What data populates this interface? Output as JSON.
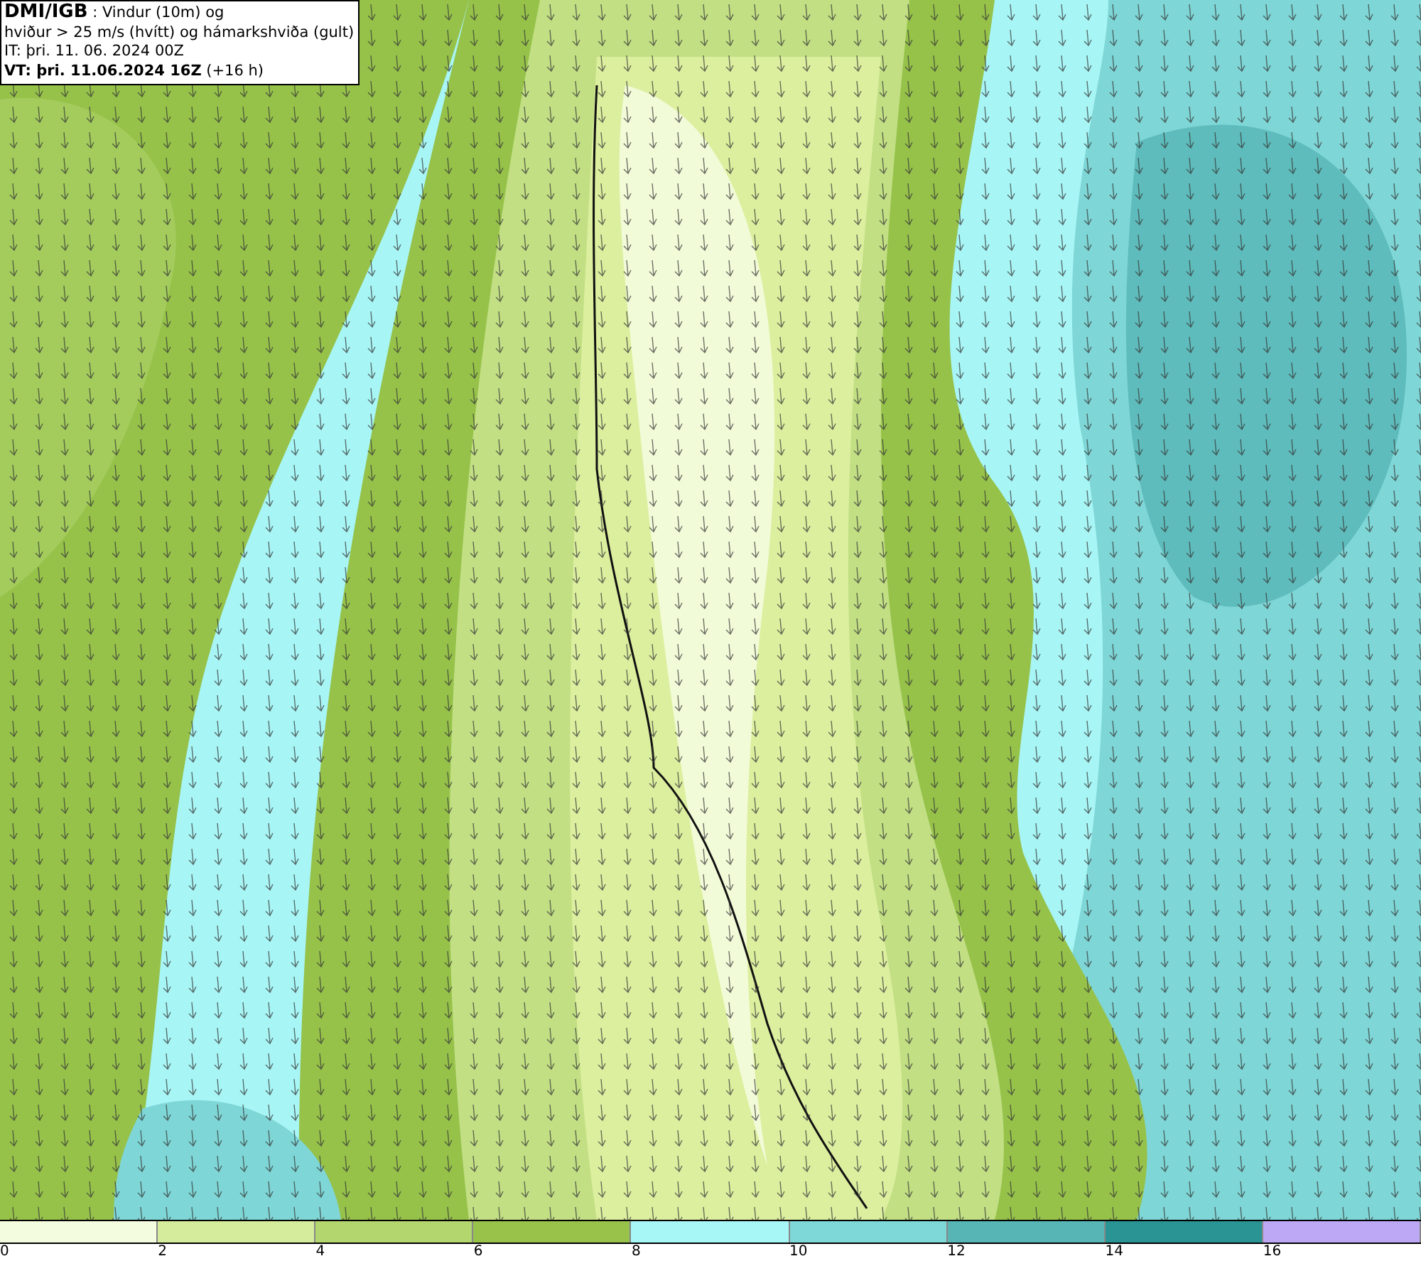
{
  "header": {
    "lines": [
      "**DMI/IGB** : Vindur (10m) og",
      "hviður > 25 m/s (hvítt) og hámarkshviða (gult)",
      "IT: þri. 11. 06. 2024 00Z",
      "**VT: þri. 11.06.2024 16Z** (+16 h)"
    ]
  },
  "legend": {
    "segments": [
      {
        "color": "#f3fcde"
      },
      {
        "color": "#d4ec9c"
      },
      {
        "color": "#b4d66e"
      },
      {
        "color": "#98c24a"
      },
      {
        "color": "#a8f7f7"
      },
      {
        "color": "#7fd8d8"
      },
      {
        "color": "#57b5b5"
      },
      {
        "color": "#2a9494"
      },
      {
        "color": "#bca8f4"
      }
    ],
    "ticks": [
      "0",
      "2",
      "4",
      "6",
      "8",
      "10",
      "12",
      "14",
      "16"
    ]
  }
}
